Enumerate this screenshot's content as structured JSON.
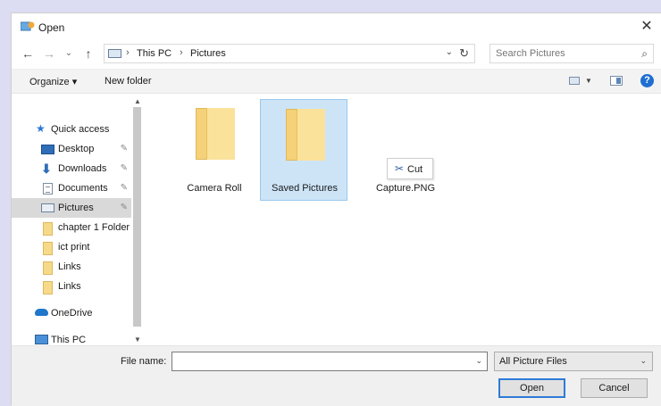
{
  "window": {
    "title": "Open",
    "close_symbol": "✕"
  },
  "address_bar": {
    "back_symbol": "←",
    "forward_symbol": "→",
    "recent_symbol": "⌄",
    "up_symbol": "↑",
    "location_icon": "pc-icon",
    "breadcrumbs": [
      "This PC",
      "Pictures"
    ],
    "separator": "›",
    "dropdown_symbol": "⌄",
    "refresh_symbol": "↻"
  },
  "search": {
    "placeholder": "Search Pictures",
    "value": "",
    "icon_symbol": "⌕"
  },
  "toolbar": {
    "organize_label": "Organize ▾",
    "new_folder_label": "New folder",
    "view_caret": "▼",
    "help_symbol": "?"
  },
  "nav_pane": {
    "items": [
      {
        "label": "Quick access",
        "icon": "star-icon",
        "pinned": false
      },
      {
        "label": "Desktop",
        "icon": "desktop-icon",
        "pinned": true
      },
      {
        "label": "Downloads",
        "icon": "download-icon",
        "pinned": true
      },
      {
        "label": "Documents",
        "icon": "document-icon",
        "pinned": true
      },
      {
        "label": "Pictures",
        "icon": "pictures-icon",
        "pinned": true,
        "selected": true
      },
      {
        "label": "chapter 1 Folder",
        "icon": "folder-icon",
        "pinned": false
      },
      {
        "label": "ict print",
        "icon": "folder-icon",
        "pinned": false
      },
      {
        "label": "Links",
        "icon": "folder-icon",
        "pinned": false
      },
      {
        "label": "Links",
        "icon": "folder-icon",
        "pinned": false
      },
      {
        "label": "OneDrive",
        "icon": "cloud-icon",
        "pinned": false
      },
      {
        "label": "This PC",
        "icon": "pc-icon",
        "pinned": false
      }
    ],
    "pin_symbol": "📌",
    "scroll_up": "▲",
    "scroll_down": "▼"
  },
  "content": {
    "items": [
      {
        "name": "Camera Roll",
        "type": "folder",
        "selected": false
      },
      {
        "name": "Saved Pictures",
        "type": "folder",
        "selected": true
      },
      {
        "name": "Capture.PNG",
        "type": "file",
        "selected": false
      }
    ],
    "cut_tooltip": {
      "icon_symbol": "✂",
      "label": "Cut"
    }
  },
  "bottom": {
    "file_name_label": "File name:",
    "file_name_value": "",
    "file_name_caret": "⌄",
    "file_type_value": "All Picture Files",
    "file_type_caret": "⌄",
    "open_label": "Open",
    "cancel_label": "Cancel"
  },
  "colors": {
    "background": "#dcdcf2",
    "selection": "#cde4f7",
    "folder": "#f5d17a",
    "accent": "#2f7bd6"
  }
}
